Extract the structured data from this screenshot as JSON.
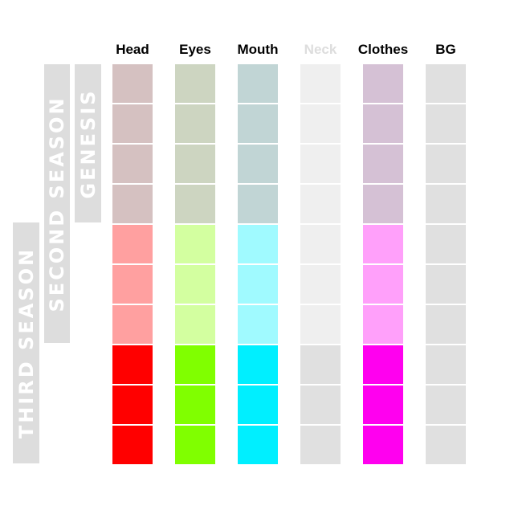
{
  "columns": [
    {
      "label": "Head",
      "color": "#000000",
      "label_color": "#000000"
    },
    {
      "label": "Eyes",
      "label_color": "#000000"
    },
    {
      "label": "Mouth",
      "label_color": "#000000"
    },
    {
      "label": "Neck",
      "label_color": "#dddddd"
    },
    {
      "label": "Clothes",
      "label_color": "#000000"
    },
    {
      "label": "BG",
      "label_color": "#000000"
    }
  ],
  "seasons": [
    {
      "label": "GENESIS",
      "rows": 4
    },
    {
      "label": "SECOND SEASON",
      "rows": 7
    },
    {
      "label": "THIRD SEASON",
      "rows": 6
    }
  ],
  "grid_colors": [
    [
      "#d5c1c1",
      "#cdd5c1",
      "#c1d5d5",
      "#efefef",
      "#d5c1d5",
      "#e0e0e0"
    ],
    [
      "#d5c1c1",
      "#cdd5c1",
      "#c1d5d5",
      "#efefef",
      "#d5c1d5",
      "#e0e0e0"
    ],
    [
      "#d5c1c1",
      "#cdd5c1",
      "#c1d5d5",
      "#efefef",
      "#d5c1d5",
      "#e0e0e0"
    ],
    [
      "#d5c1c1",
      "#cdd5c1",
      "#c1d5d5",
      "#efefef",
      "#d5c1d5",
      "#e0e0e0"
    ],
    [
      "#ffa0a0",
      "#d3ffa0",
      "#a0faff",
      "#efefef",
      "#ffa0fa",
      "#e0e0e0"
    ],
    [
      "#ffa0a0",
      "#d3ffa0",
      "#a0faff",
      "#efefef",
      "#ffa0fa",
      "#e0e0e0"
    ],
    [
      "#ffa0a0",
      "#d3ffa0",
      "#a0faff",
      "#efefef",
      "#ffa0fa",
      "#e0e0e0"
    ],
    [
      "#ff0000",
      "#80ff00",
      "#00efff",
      "#e0e0e0",
      "#ff00ef",
      "#e0e0e0"
    ],
    [
      "#ff0000",
      "#80ff00",
      "#00efff",
      "#e0e0e0",
      "#ff00ef",
      "#e0e0e0"
    ],
    [
      "#ff0000",
      "#80ff00",
      "#00efff",
      "#e0e0e0",
      "#ff00ef",
      "#e0e0e0"
    ]
  ],
  "bracket_color": "#dddddd"
}
